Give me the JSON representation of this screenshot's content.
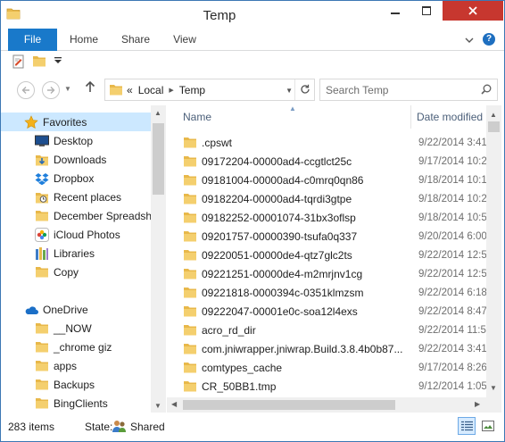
{
  "window": {
    "title": "Temp"
  },
  "ribbon": {
    "tabs": [
      "File",
      "Home",
      "Share",
      "View"
    ],
    "help_glyph": "?"
  },
  "address": {
    "overflow": "«",
    "crumbs": [
      "Local",
      "Temp"
    ]
  },
  "search": {
    "placeholder": "Search Temp"
  },
  "nav": {
    "favorites_label": "Favorites",
    "favorites": [
      {
        "label": "Desktop",
        "icon": "desktop-icon"
      },
      {
        "label": "Downloads",
        "icon": "downloads-icon"
      },
      {
        "label": "Dropbox",
        "icon": "dropbox-icon"
      },
      {
        "label": "Recent places",
        "icon": "recent-places-icon"
      },
      {
        "label": "December Spreadshe",
        "icon": "folder-icon"
      },
      {
        "label": "iCloud Photos",
        "icon": "icloud-photos-icon"
      },
      {
        "label": "Libraries",
        "icon": "libraries-icon"
      },
      {
        "label": "Copy",
        "icon": "folder-icon"
      }
    ],
    "onedrive_label": "OneDrive",
    "onedrive": [
      {
        "label": "__NOW"
      },
      {
        "label": "_chrome giz"
      },
      {
        "label": "apps"
      },
      {
        "label": "Backups"
      },
      {
        "label": "BingClients"
      }
    ]
  },
  "list": {
    "columns": {
      "name": "Name",
      "date": "Date modified"
    },
    "rows": [
      {
        "name": ".cpswt",
        "date": "9/22/2014 3:41",
        "type": "folder"
      },
      {
        "name": "09172204-00000ad4-ccgtlct25c",
        "date": "9/17/2014 10:2",
        "type": "folder"
      },
      {
        "name": "09181004-00000ad4-c0mrq0qn86",
        "date": "9/18/2014 10:1",
        "type": "folder"
      },
      {
        "name": "09182204-00000ad4-tqrdi3gtpe",
        "date": "9/18/2014 10:2",
        "type": "folder"
      },
      {
        "name": "09182252-00001074-31bx3oflsp",
        "date": "9/18/2014 10:5",
        "type": "folder"
      },
      {
        "name": "09201757-00000390-tsufa0q337",
        "date": "9/20/2014 6:00",
        "type": "folder"
      },
      {
        "name": "09220051-00000de4-qtz7glc2ts",
        "date": "9/22/2014 12:5",
        "type": "folder"
      },
      {
        "name": "09221251-00000de4-m2mrjnv1cg",
        "date": "9/22/2014 12:5",
        "type": "folder"
      },
      {
        "name": "09221818-0000394c-0351klmzsm",
        "date": "9/22/2014 6:18",
        "type": "folder"
      },
      {
        "name": "09222047-00001e0c-soa12l4exs",
        "date": "9/22/2014 8:47",
        "type": "folder"
      },
      {
        "name": "acro_rd_dir",
        "date": "9/22/2014 11:5",
        "type": "folder"
      },
      {
        "name": "com.jniwrapper.jniwrap.Build.3.8.4b0b87...",
        "date": "9/22/2014 3:41",
        "type": "folder"
      },
      {
        "name": "comtypes_cache",
        "date": "9/17/2014 8:26",
        "type": "folder"
      },
      {
        "name": "CR_50BB1.tmp",
        "date": "9/12/2014 1:05",
        "type": "folder"
      }
    ]
  },
  "status": {
    "count": "283 items",
    "state_label": "State:",
    "shared": "Shared"
  },
  "colors": {
    "accent": "#1979ca",
    "close": "#c7372f",
    "folder": "#e8b84a",
    "selected": "#cce8ff"
  }
}
